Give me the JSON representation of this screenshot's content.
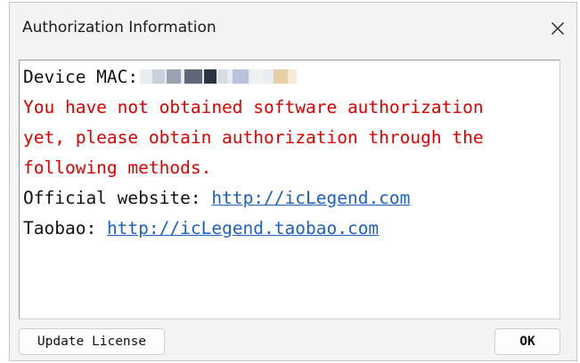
{
  "window": {
    "title": "Authorization Information",
    "close_icon": "close-icon"
  },
  "message": {
    "device_mac_label": "Device MAC:",
    "warning_lines": [
      "You have not obtained software authorization",
      "yet, please obtain authorization through the",
      "following methods."
    ],
    "official_label": "Official website:",
    "official_link": "http://icLegend.com",
    "taobao_label": "Taobao:",
    "taobao_link": "http://icLegend.taobao.com"
  },
  "buttons": {
    "update_license": "Update License",
    "ok": "OK"
  },
  "colors": {
    "warning_text": "#e00000",
    "link": "#1f5fbf"
  }
}
